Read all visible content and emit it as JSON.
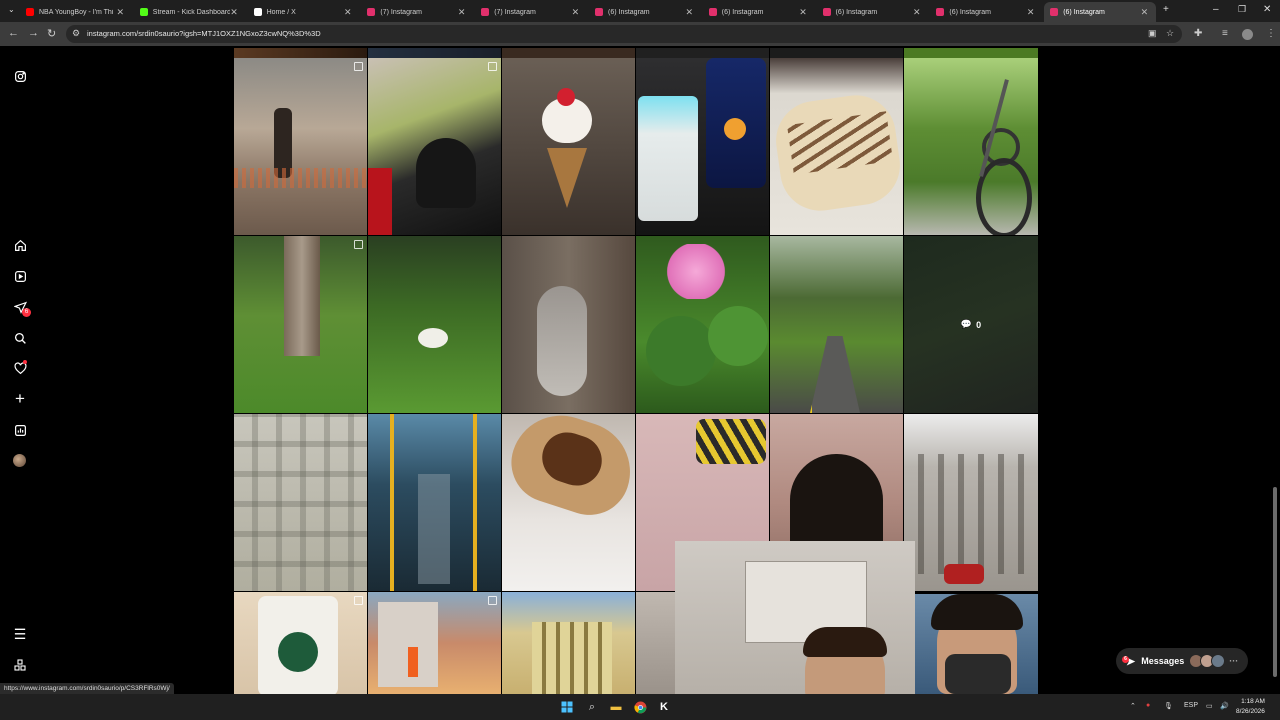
{
  "browser": {
    "tabs": [
      {
        "label": "NBA YoungBoy - I'm Thi",
        "favicon": "youtube-icon",
        "color": "#ff0000"
      },
      {
        "label": "Stream - Kick Dashboard",
        "favicon": "kick-icon",
        "color": "#53fc18"
      },
      {
        "label": "Home / X",
        "favicon": "x-icon",
        "color": "#ffffff"
      },
      {
        "label": "(7) Instagram",
        "favicon": "instagram-icon",
        "color": "#e1306c"
      },
      {
        "label": "(7) Instagram",
        "favicon": "instagram-icon",
        "color": "#e1306c"
      },
      {
        "label": "(6) Instagram",
        "favicon": "instagram-icon",
        "color": "#e1306c"
      },
      {
        "label": "(6) Instagram",
        "favicon": "instagram-icon",
        "color": "#e1306c"
      },
      {
        "label": "(6) Instagram",
        "favicon": "instagram-icon",
        "color": "#e1306c"
      },
      {
        "label": "(6) Instagram",
        "favicon": "instagram-icon",
        "color": "#e1306c"
      },
      {
        "label": "(6) Instagram",
        "favicon": "instagram-icon",
        "color": "#e1306c",
        "active": true
      }
    ],
    "url": "instagram.com/srdin0saurio?igsh=MTJ1OXZ1NGxoZ3cwNQ%3D%3D",
    "status_url": "https://www.instagram.com/srdin0saurio/p/CS3RFlRs0Wj/"
  },
  "instagram": {
    "notification_badge": "6",
    "messages_label": "Messages",
    "messages_badge": "6",
    "post_overlay_comments": "0"
  },
  "taskbar": {
    "language": "ESP",
    "time": "1:18 AM",
    "date": "8/26/2026"
  }
}
